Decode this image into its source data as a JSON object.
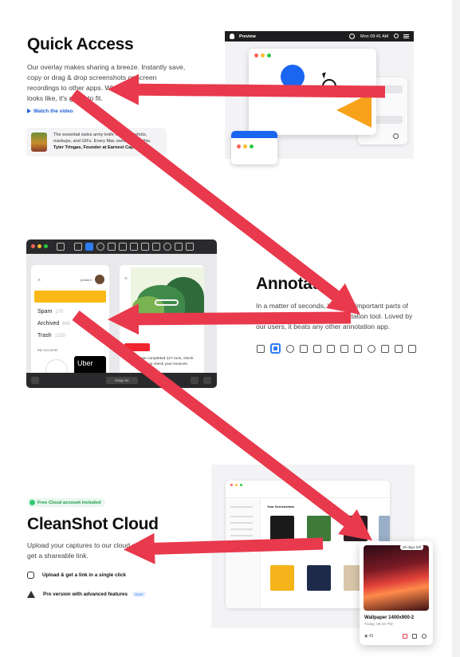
{
  "quick_access": {
    "title": "Quick Access",
    "description": "Our overlay makes sharing a breeze. Instantly save, copy or drag & drop screenshots or screen recordings to other apps. Whatever your workflow looks like, it's going to fit.",
    "watch_link": "Watch the video",
    "testimonial": {
      "quote": "The essential swiss army knife for screenshots, markups, and GIFs. Every Mac owner needs this.",
      "author": "Tyler Tringas, Founder at Earnest Capital"
    },
    "mock": {
      "app_name": "Preview",
      "clock": "Mon 09:41 AM"
    }
  },
  "annotate": {
    "title": "Annotate",
    "description": "In a matter of seconds, highlight important parts of your screenshots with our annotation tool. Loved by our users, it beats any other annotation app.",
    "tools": [
      "square-tool-icon",
      "highlight-tool-icon",
      "ellipse-tool-icon",
      "line-tool-icon",
      "arrow-tool-icon",
      "text-tool-icon",
      "blur-tool-icon",
      "pixelate-tool-icon",
      "counter-tool-icon",
      "pen-tool-icon",
      "crop-tool-icon",
      "rotate-tool-icon"
    ],
    "mock": {
      "list": [
        {
          "label": "Spam",
          "count": "170"
        },
        {
          "label": "Archived",
          "count": "660"
        },
        {
          "label": "Trash",
          "count": "1250"
        }
      ],
      "accounts_label": "My accounts",
      "user_name": "jordan.h",
      "uber_label": "Uber",
      "completion_text": "You have completed 127 runs, check your inbox to check your invoices.",
      "dropdown": "Drag me"
    }
  },
  "cloud": {
    "badge": "Free Cloud account included",
    "title": "CleanShot Cloud",
    "description": "Upload your captures to our cloud and instantly get a shareable link.",
    "features": [
      {
        "label": "Upload & get a link in a single click",
        "badge": ""
      },
      {
        "label": "Pro version with advanced features",
        "badge": "Soon"
      }
    ],
    "mock": {
      "header": "Your Screenshots",
      "days_left": "30 days left",
      "file_name": "Wallpaper 1400x900-2",
      "file_time": "Today, 09:40 PM",
      "views": "43"
    }
  },
  "colors": {
    "arrow": "#e8394d",
    "accent_blue": "#2f7cf6",
    "cloud_green": "#1f9a4a"
  }
}
